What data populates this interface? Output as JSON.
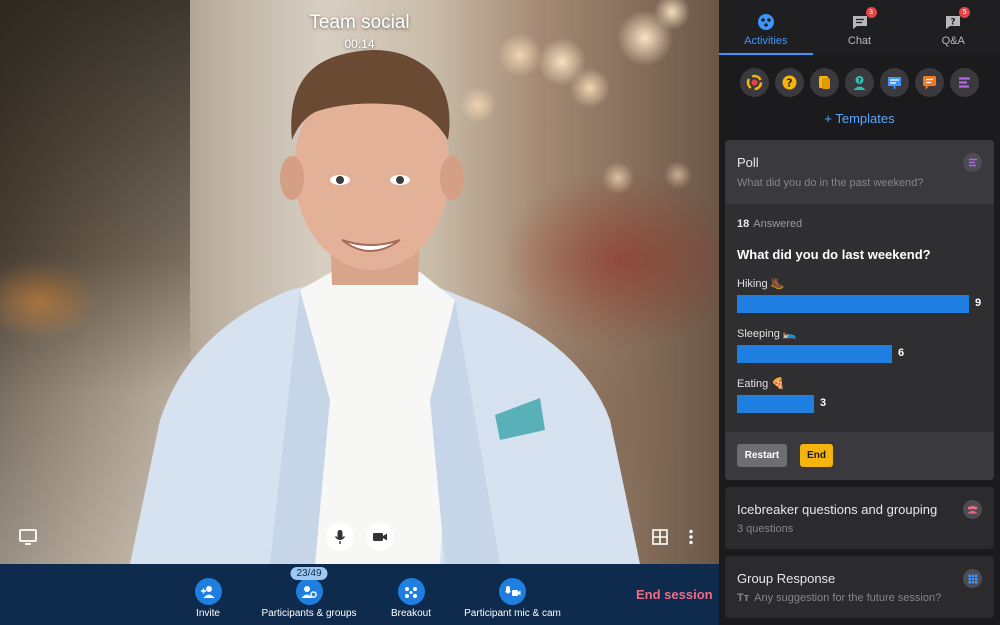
{
  "video": {
    "title": "Team social",
    "timer": "00:14"
  },
  "bottombar": {
    "invite_label": "Invite",
    "participants_label": "Participants & groups",
    "participants_count": "23/49",
    "breakout_label": "Breakout",
    "micam_label": "Participant mic & cam",
    "end_session_label": "End session"
  },
  "panel": {
    "tabs": [
      {
        "label": "Activities",
        "icon": "activities-icon",
        "badge": ""
      },
      {
        "label": "Chat",
        "icon": "chat-icon",
        "badge": "3"
      },
      {
        "label": "Q&A",
        "icon": "qa-icon",
        "badge": "5"
      }
    ],
    "templates_label": "+ Templates"
  },
  "poll": {
    "title": "Poll",
    "subtitle": "What did you do in the past weekend?",
    "answered_count": "18",
    "answered_label": "Answered",
    "question": "What did you do last weekend?",
    "options": [
      {
        "label": "Hiking 🥾",
        "count": "9",
        "fraction": 1.0
      },
      {
        "label": "Sleeping 🛌",
        "count": "6",
        "fraction": 0.667
      },
      {
        "label": "Eating 🍕",
        "count": "3",
        "fraction": 0.333
      }
    ],
    "restart_label": "Restart",
    "end_label": "End"
  },
  "icebreaker": {
    "title": "Icebreaker questions and grouping",
    "subtitle": "3 questions"
  },
  "group_response": {
    "title": "Group Response",
    "subtitle": "Any suggestion for the future session?"
  },
  "colors": {
    "accent": "#1e7fe0",
    "end_button": "#f6b40e",
    "end_session": "#f26a86",
    "bottom_bar": "#0e2a4c"
  }
}
